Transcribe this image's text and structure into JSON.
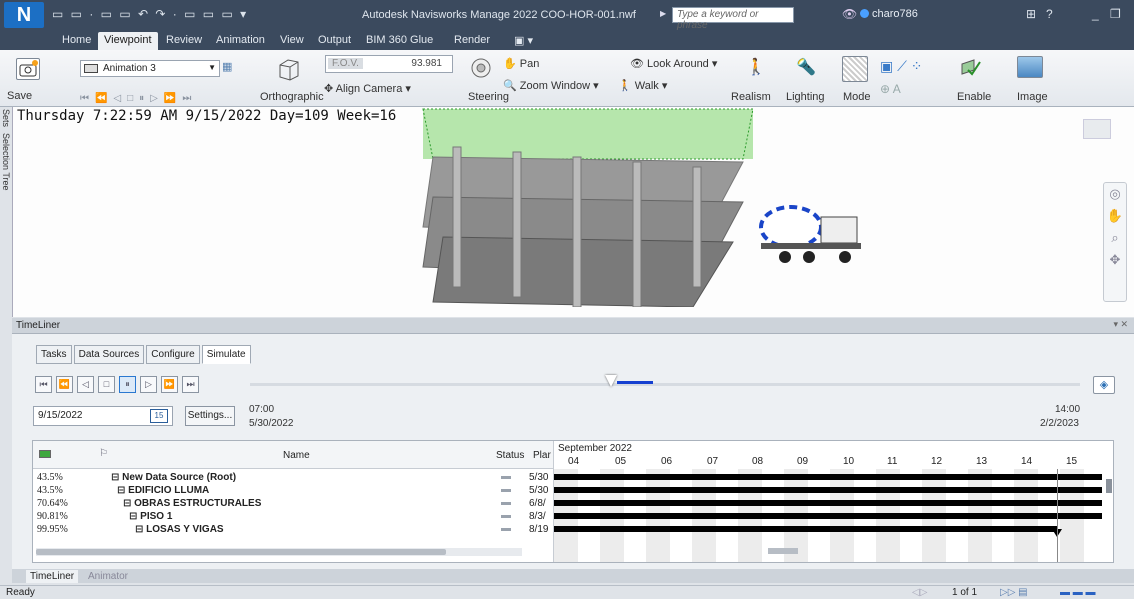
{
  "window": {
    "app_button": "N",
    "title": "Autodesk Navisworks Manage 2022   COO-HOR-001.nwf",
    "search_placeholder": "Type a keyword or phrase",
    "user": "charo786"
  },
  "ribbon_tabs": [
    {
      "label": "Home"
    },
    {
      "label": "Viewpoint",
      "active": true
    },
    {
      "label": "Review"
    },
    {
      "label": "Animation"
    },
    {
      "label": "View"
    },
    {
      "label": "Output"
    },
    {
      "label": "BIM 360 Glue"
    },
    {
      "label": "Render"
    }
  ],
  "ribbon": {
    "save": "Save",
    "animation_select": "Animation 3",
    "orthographic": "Orthographic",
    "fov_label": "F.O.V.",
    "fov_value": "93.981",
    "align_camera": "Align Camera",
    "steering": "Steering",
    "pan": "Pan",
    "zoom_window": "Zoom Window",
    "look_around": "Look Around",
    "walk": "Walk",
    "realism": "Realism",
    "lighting": "Lighting",
    "mode": "Mode",
    "enable": "Enable",
    "image": "Image"
  },
  "sidebar": {
    "sets": "Sets",
    "selection_tree": "Selection Tree"
  },
  "viewport": {
    "overlay_text": "Thursday 7:22:59 AM 9/15/2022 Day=109 Week=16"
  },
  "timeliner": {
    "title": "TimeLiner",
    "tabs": [
      {
        "label": "Tasks"
      },
      {
        "label": "Data Sources"
      },
      {
        "label": "Configure"
      },
      {
        "label": "Simulate",
        "active": true
      }
    ],
    "current_date": "9/15/2022",
    "calendar_day": "15",
    "settings": "Settings...",
    "start_time": "07:00",
    "start_date": "5/30/2022",
    "end_time": "14:00",
    "end_date": "2/2/2023",
    "slider_progress": 0.44,
    "columns": {
      "name": "Name",
      "status": "Status",
      "planned": "Plar"
    },
    "rows": [
      {
        "pct": "43.5%",
        "name": "⊟ New Data Source (Root)",
        "indent": 0,
        "planned": "5/30"
      },
      {
        "pct": "43.5%",
        "name": "⊟ EDIFICIO LLUMA",
        "indent": 1,
        "planned": "5/30"
      },
      {
        "pct": "70.64%",
        "name": "⊟ OBRAS ESTRUCTURALES",
        "indent": 2,
        "planned": "6/8/"
      },
      {
        "pct": "90.81%",
        "name": "⊟ PISO 1",
        "indent": 3,
        "planned": "8/3/"
      },
      {
        "pct": "99.95%",
        "name": "⊟ LOSAS Y VIGAS",
        "indent": 4,
        "planned": "8/19"
      }
    ],
    "gantt": {
      "month": "September 2022",
      "days": [
        "04",
        "05",
        "06",
        "07",
        "08",
        "09",
        "10",
        "11",
        "12",
        "13",
        "14",
        "15"
      ]
    }
  },
  "bottom_tabs": [
    {
      "label": "TimeLiner",
      "active": true
    },
    {
      "label": "Animator"
    }
  ],
  "status": {
    "left": "Ready",
    "page": "1 of 1"
  }
}
